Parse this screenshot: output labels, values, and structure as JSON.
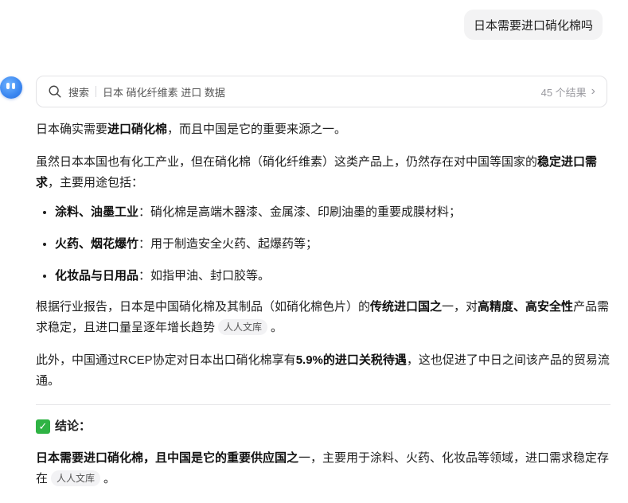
{
  "user_message": "日本需要进口硝化棉吗",
  "search": {
    "label": "搜索",
    "query": "日本 硝化纤维素 进口 数据",
    "result_count": "45 个结果"
  },
  "answer": {
    "p1": {
      "a": "日本确实需要",
      "b": "进口硝化棉",
      "c": "，而且中国是它的重要来源之一。"
    },
    "p2": {
      "a": "虽然日本本国也有化工产业，但在硝化棉（硝化纤维素）这类产品上，仍然存在对中国等国家的",
      "b": "稳定进口需求",
      "c": "，主要用途包括："
    },
    "bullets": [
      {
        "title": "涂料、油墨工业",
        "text": "：硝化棉是高端木器漆、金属漆、印刷油墨的重要成膜材料；"
      },
      {
        "title": "火药、烟花爆竹",
        "text": "：用于制造安全火药、起爆药等；"
      },
      {
        "title": "化妆品与日用品",
        "text": "：如指甲油、封口胶等。"
      }
    ],
    "p3": {
      "a": "根据行业报告，日本是中国硝化棉及其制品（如硝化棉色片）的",
      "b": "传统进口国之",
      "c": "一，对",
      "d": "高精度、高安全性",
      "e": "产品需求稳定，且进口量呈逐年增长趋势",
      "source": "人人文库",
      "end": "。"
    },
    "p4": {
      "a": "此外，中国通过RCEP协定对日本出口硝化棉享有",
      "b": "5.9%的进口关税待遇",
      "c": "，这也促进了中日之间该产品的贸易流通。"
    },
    "conclusion": {
      "heading": "结论：",
      "a": "日本需要进口硝化棉，且中国是它的重要供应国之",
      "b": "一，主要用于涂料、火药、化妆品等领域，进口需求稳定存在",
      "source": "人人文库",
      "end": "。"
    }
  },
  "colors": {
    "accent_blue": "#3a86f0",
    "check_green": "#2fb344",
    "bubble_bg": "#f3f3f4"
  }
}
